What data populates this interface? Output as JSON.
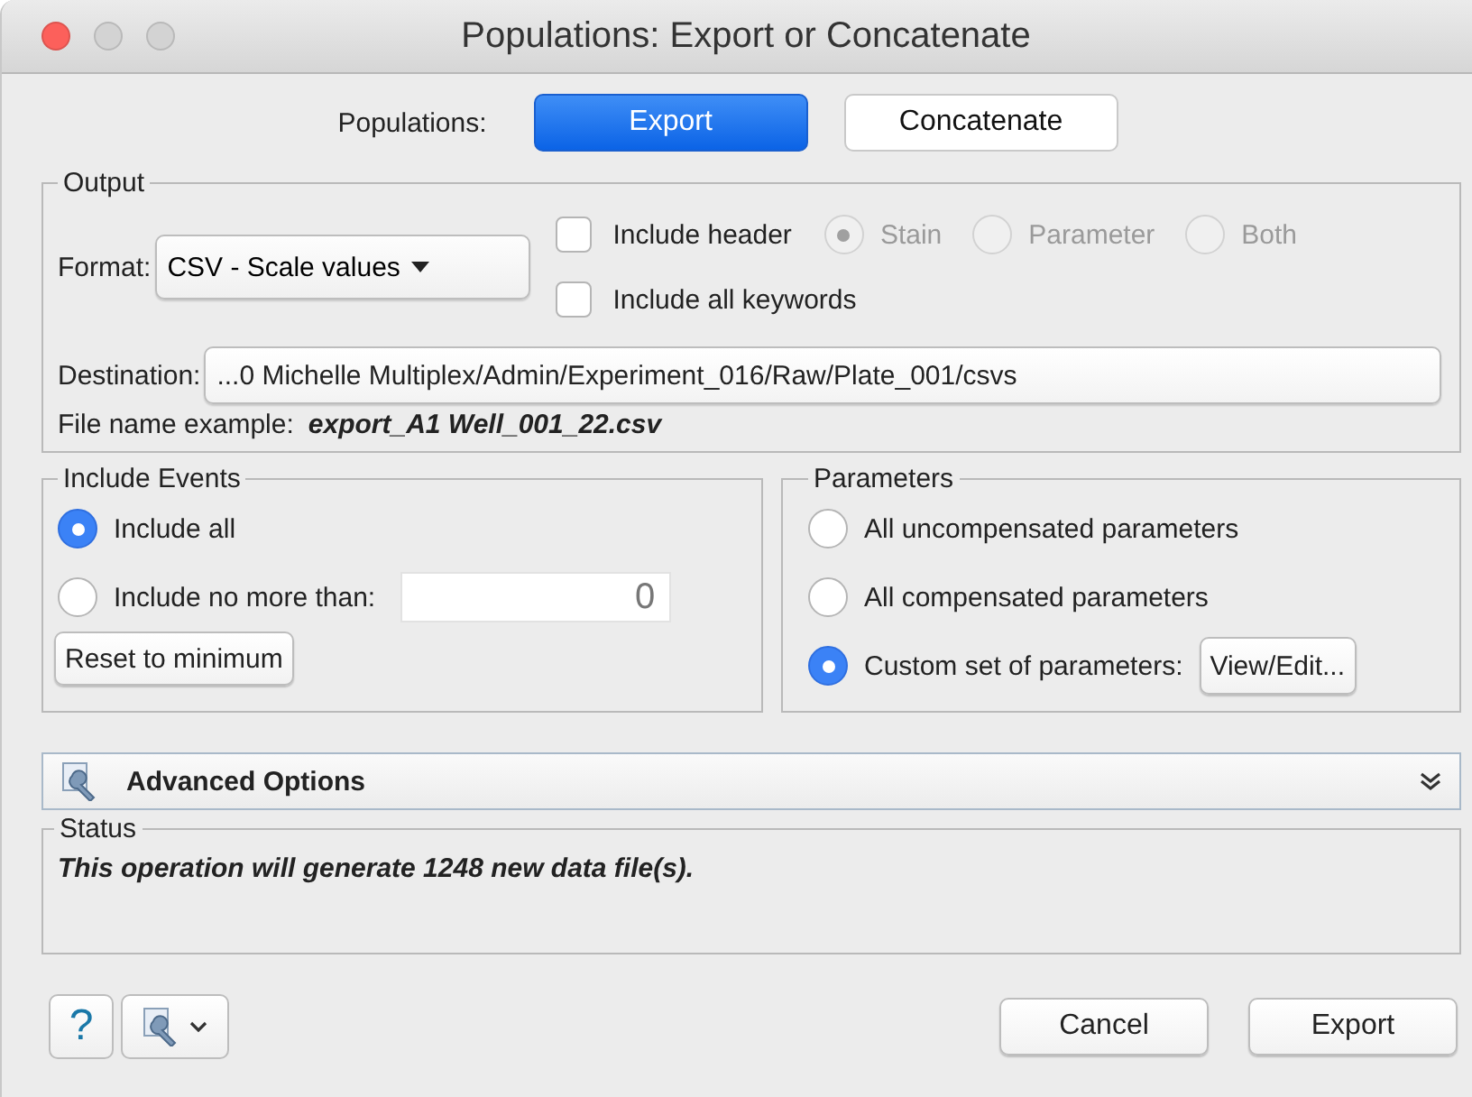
{
  "window": {
    "title": "Populations: Export or Concatenate"
  },
  "mode": {
    "label": "Populations:",
    "buttons": [
      {
        "label": "Export",
        "selected": true
      },
      {
        "label": "Concatenate",
        "selected": false
      }
    ]
  },
  "output": {
    "legend": "Output",
    "format_label": "Format:",
    "format_value": "CSV - Scale values",
    "checkboxes": [
      {
        "label": "Include header",
        "checked": false
      },
      {
        "label": "Include all keywords",
        "checked": false
      }
    ],
    "header_options": [
      {
        "label": "Stain",
        "selected": true,
        "disabled": true
      },
      {
        "label": "Parameter",
        "selected": false,
        "disabled": true
      },
      {
        "label": "Both",
        "selected": false,
        "disabled": true
      }
    ],
    "destination_label": "Destination:",
    "destination_value": "...0 Michelle Multiplex/Admin/Experiment_016/Raw/Plate_001/csvs",
    "example_label": "File name example:",
    "example_value": "export_A1 Well_001_22.csv"
  },
  "include_events": {
    "legend": "Include Events",
    "options": [
      {
        "kind": "plain",
        "label": "Include all",
        "selected": true
      },
      {
        "kind": "with_field",
        "label": "Include no more than:",
        "selected": false,
        "value": "0"
      }
    ],
    "reset_button": "Reset to minimum"
  },
  "parameters": {
    "legend": "Parameters",
    "options": [
      {
        "kind": "plain",
        "label": "All uncompensated parameters",
        "selected": false
      },
      {
        "kind": "plain",
        "label": "All compensated parameters",
        "selected": false
      },
      {
        "kind": "with_button",
        "label": "Custom set of parameters:",
        "selected": true,
        "button": "View/Edit..."
      }
    ]
  },
  "advanced": {
    "title": "Advanced Options",
    "expanded": false
  },
  "status": {
    "legend": "Status",
    "message": "This operation will generate 1248 new data file(s)."
  },
  "footer": {
    "help": "?",
    "buttons": [
      {
        "label": "Cancel"
      },
      {
        "label": "Export"
      }
    ]
  }
}
